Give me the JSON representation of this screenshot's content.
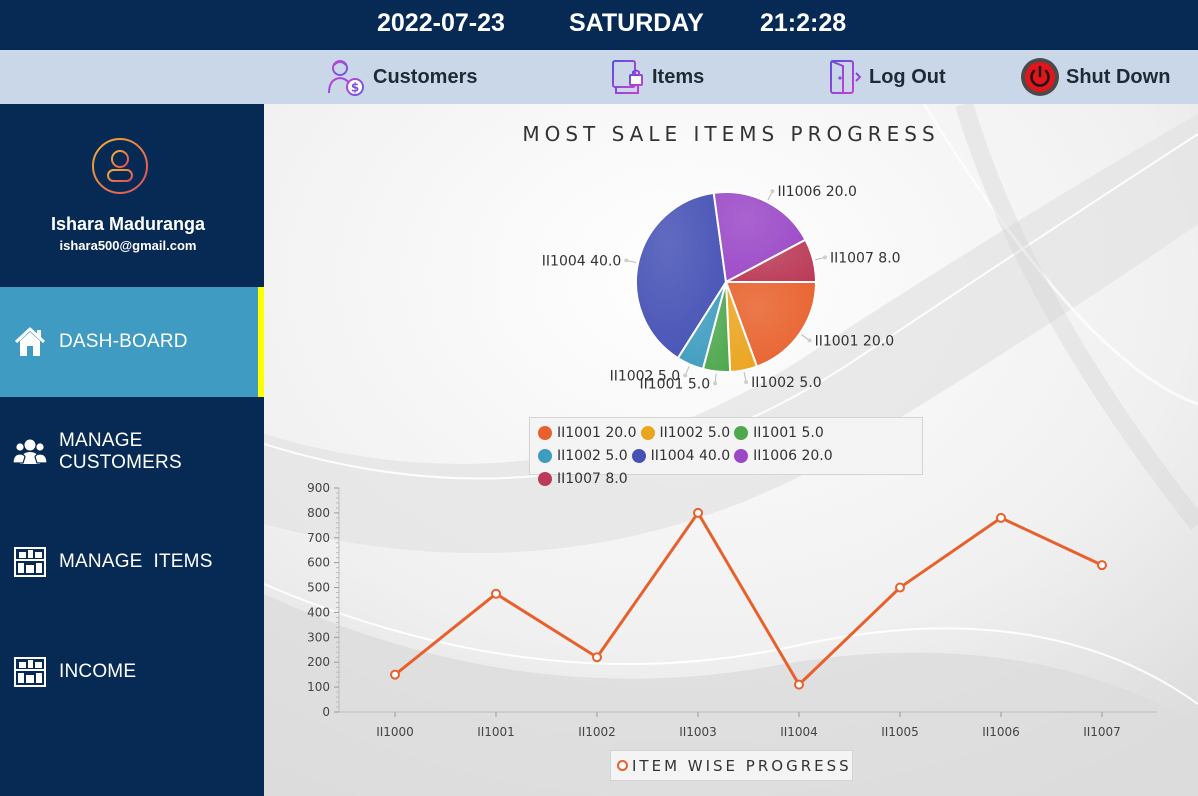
{
  "header": {
    "date": "2022-07-23",
    "day": "SATURDAY",
    "time": "21:2:28"
  },
  "menubar": {
    "customers_label": "Customers",
    "items_label": "Items",
    "logout_label": "Log Out",
    "shutdown_label": "Shut Down"
  },
  "sidebar": {
    "user_name": "Ishara Maduranga",
    "user_email": "ishara500@gmail.com",
    "items": [
      {
        "label": "DASH-BOARD",
        "icon": "home-icon",
        "active": true
      },
      {
        "label": "MANAGE CUSTOMERS",
        "icon": "users-icon",
        "active": false
      },
      {
        "label": "MANAGE  ITEMS",
        "icon": "store-icon",
        "active": false
      },
      {
        "label": "INCOME",
        "icon": "store-icon",
        "active": false
      }
    ]
  },
  "colors": {
    "header_bg": "#072a55",
    "menubar_bg": "#c9d7e8",
    "active_nav": "#3f9bc2",
    "active_indicator": "#ffff00",
    "line_series": "#e8612c"
  },
  "chart_data": [
    {
      "type": "pie",
      "title": "MOST SALE ITEMS PROGRESS",
      "slices": [
        {
          "label": "II1001 20.0",
          "value": 20.0,
          "color": "#e8612c"
        },
        {
          "label": "II1002 5.0",
          "value": 5.0,
          "color": "#eba41d"
        },
        {
          "label": "II1001 5.0",
          "value": 5.0,
          "color": "#4ea84e"
        },
        {
          "label": "II1002 5.0",
          "value": 5.0,
          "color": "#3e9cbf"
        },
        {
          "label": "II1004 40.0",
          "value": 40.0,
          "color": "#4551b5"
        },
        {
          "label": "II1006 20.0",
          "value": 20.0,
          "color": "#9b48c7"
        },
        {
          "label": "II1007 8.0",
          "value": 8.0,
          "color": "#bb3a57"
        }
      ],
      "legend_placement": "bottom"
    },
    {
      "type": "line",
      "title": "",
      "categories": [
        "II1000",
        "II1001",
        "II1002",
        "II1003",
        "II1004",
        "II1005",
        "II1006",
        "II1007"
      ],
      "series": [
        {
          "name": "ITEM WISE PROGRESS",
          "values": [
            150,
            475,
            220,
            800,
            110,
            500,
            780,
            590
          ]
        }
      ],
      "ylim": [
        0,
        900
      ],
      "yticks": [
        0,
        100,
        200,
        300,
        400,
        500,
        600,
        700,
        800,
        900
      ],
      "legend_placement": "bottom",
      "grid": false
    }
  ]
}
